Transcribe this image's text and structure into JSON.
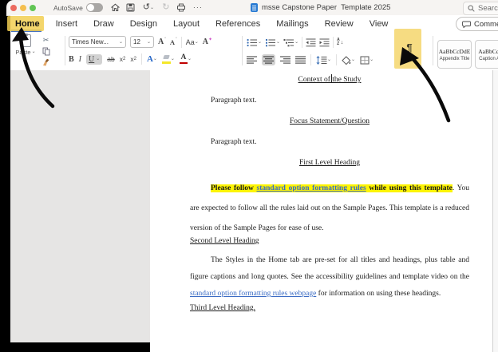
{
  "window": {
    "autosave": "AutoSave",
    "title": "msse Capstone Paper  Template 2025",
    "search": "Search",
    "ellipsis": "···"
  },
  "tabs": {
    "items": [
      "Home",
      "Insert",
      "Draw",
      "Design",
      "Layout",
      "References",
      "Mailings",
      "Review",
      "View"
    ],
    "active": "Home",
    "comments": "Comme"
  },
  "icons": {
    "undo": "↺",
    "redo": "↻",
    "cut": "✂",
    "chevron": "⌄"
  },
  "ribbon": {
    "clipboard": {
      "paste": "Paste"
    },
    "font": {
      "name": "Times New...",
      "size": "12",
      "grow": "A",
      "grow_mark": "ˆ",
      "shrink": "A",
      "shrink_mark": "ˇ",
      "change_case": "Aa",
      "clear_formatting": "A",
      "clear_mark": "✦",
      "bold": "B",
      "italic": "I",
      "underline": "U",
      "strikethrough": "ab",
      "subscript_base": "x",
      "subscript_digit": "2",
      "superscript_base": "x",
      "superscript_digit": "2",
      "text_effects": "A",
      "font_color": "A"
    },
    "paragraph": {
      "sort_a": "A",
      "sort_z": "Z",
      "sort_arrow": "↓",
      "pilcrow": "¶"
    },
    "styles": [
      {
        "sample": "AaBbCcDdE",
        "label": "Appendix Title"
      },
      {
        "sample": "AaBbCcDc",
        "label": "Caption Abo"
      }
    ]
  },
  "document": {
    "heading_context": "Context of the Study",
    "para_text_1": "Paragraph text.",
    "heading_focus": "Focus Statement/Question",
    "para_text_2": "Paragraph text.",
    "heading_first": "First Level Heading",
    "para_first": {
      "highlight_lead": "Please follow ",
      "highlight_link": "standard option formatting rules",
      "highlight_tail": " while using this template",
      "rest": ". You are expected to follow all the rules laid out on the Sample Pages. This template is a reduced version of the Sample Pages for ease of use."
    },
    "heading_second": "Second Level Heading",
    "para_second": {
      "lead": "The Styles in the Home tab are pre-set for all titles and headings, plus table and figure captions and long quotes. See the accessibility guidelines and template video on the ",
      "link": "standard option formatting rules webpage",
      "rest": " for information on using these headings."
    },
    "heading_third": "Third Level Heading."
  },
  "colors": {
    "annotation_highlight": "#f2cf52",
    "doc_highlight": "#fdf403",
    "link": "#3b6cc4",
    "active_tab_underline": "#4472c4",
    "traffic_red": "#ec6a5e",
    "traffic_yellow": "#f5bf4f",
    "traffic_green": "#61c554"
  }
}
